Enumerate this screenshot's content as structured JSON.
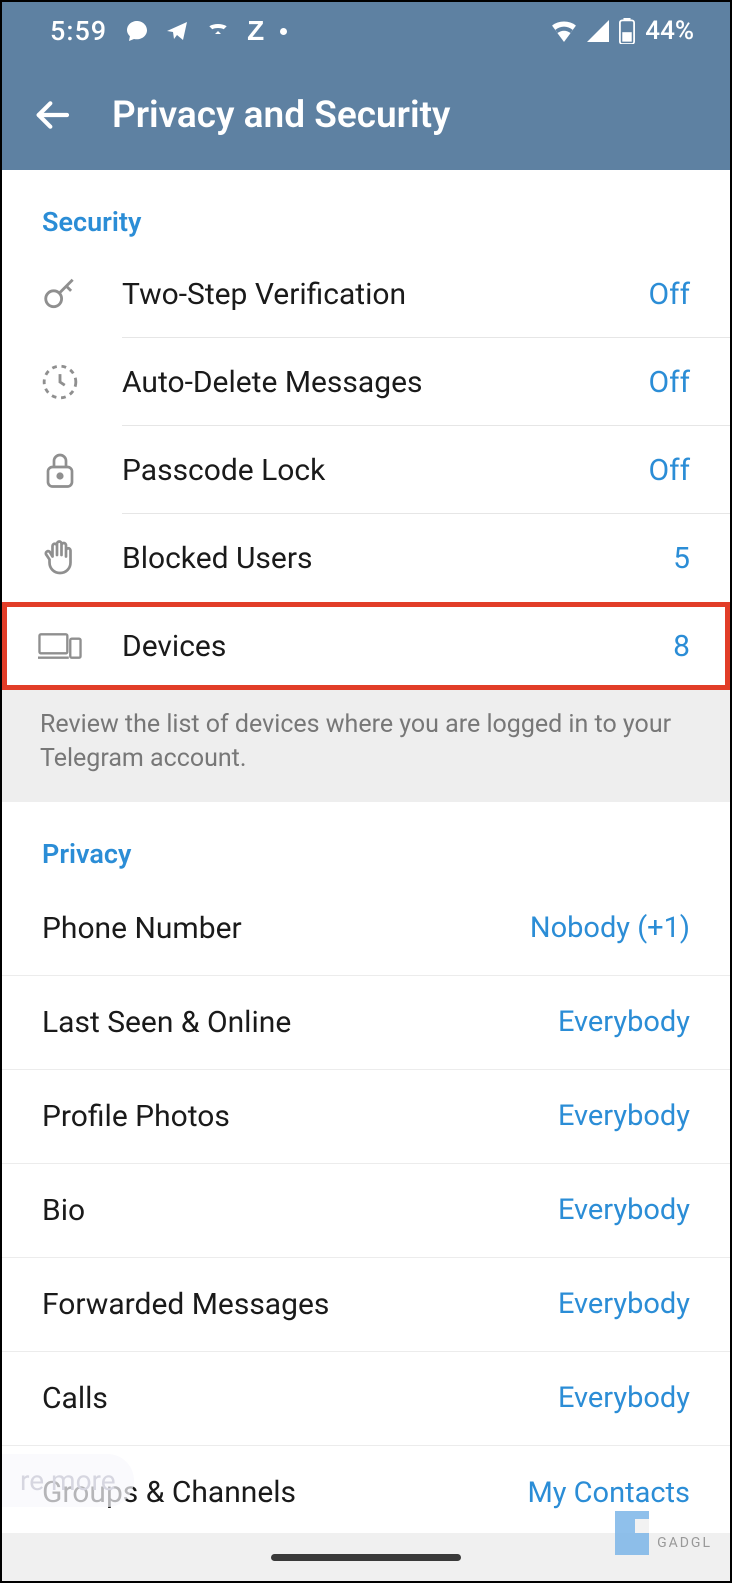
{
  "status": {
    "time": "5:59",
    "battery_pct": "44%"
  },
  "header": {
    "title": "Privacy and Security"
  },
  "security": {
    "header": "Security",
    "items": [
      {
        "icon": "key-icon",
        "label": "Two-Step Verification",
        "value": "Off"
      },
      {
        "icon": "timer-icon",
        "label": "Auto-Delete Messages",
        "value": "Off"
      },
      {
        "icon": "lock-icon",
        "label": "Passcode Lock",
        "value": "Off"
      },
      {
        "icon": "hand-icon",
        "label": "Blocked Users",
        "value": "5"
      },
      {
        "icon": "devices-icon",
        "label": "Devices",
        "value": "8"
      }
    ],
    "footer": "Review the list of devices where you are logged in to your Telegram account."
  },
  "privacy": {
    "header": "Privacy",
    "items": [
      {
        "label": "Phone Number",
        "value": "Nobody (+1)"
      },
      {
        "label": "Last Seen & Online",
        "value": "Everybody"
      },
      {
        "label": "Profile Photos",
        "value": "Everybody"
      },
      {
        "label": "Bio",
        "value": "Everybody"
      },
      {
        "label": "Forwarded Messages",
        "value": "Everybody"
      },
      {
        "label": "Calls",
        "value": "Everybody"
      },
      {
        "label": "Groups & Channels",
        "value": "My Contacts"
      }
    ]
  },
  "misc": {
    "ghost": "re more",
    "watermark": "GADGL"
  }
}
